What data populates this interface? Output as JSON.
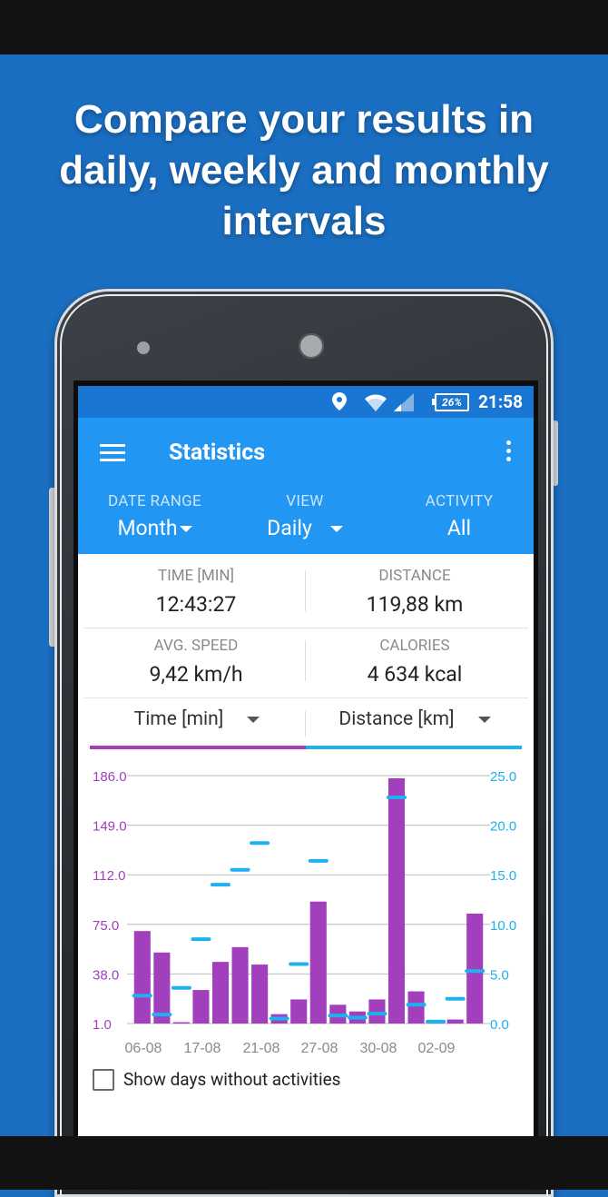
{
  "headline": {
    "line1": "Compare your results in",
    "line2": "daily, weekly and monthly",
    "line3": "intervals"
  },
  "status_bar": {
    "battery": "26%",
    "time": "21:58",
    "icons": [
      "location-icon",
      "wifi-icon",
      "signal-icon",
      "battery-icon"
    ]
  },
  "app_bar": {
    "title": "Statistics",
    "filters": [
      {
        "label": "DATE RANGE",
        "value": "Month"
      },
      {
        "label": "VIEW",
        "value": "Daily"
      },
      {
        "label": "ACTIVITY",
        "value": "All"
      }
    ]
  },
  "stats": {
    "time_label": "TIME [MIN]",
    "time_value": "12:43:27",
    "distance_label": "DISTANCE",
    "distance_value": "119,88 km",
    "speed_label": "AVG. SPEED",
    "speed_value": "9,42 km/h",
    "calories_label": "CALORIES",
    "calories_value": "4 634 kcal"
  },
  "selectors": {
    "left": "Time [min]",
    "right": "Distance [km]"
  },
  "colors": {
    "bar": "#a23fbd",
    "line": "#1fb0ee",
    "app_bar": "#2196f3",
    "status_bar": "#1976d2",
    "background": "#1b6fc2"
  },
  "chart_data": {
    "type": "bar",
    "y_left": {
      "ticks": [
        "186.0",
        "149.0",
        "112.0",
        "75.0",
        "38.0",
        "1.0"
      ],
      "range": [
        1,
        186
      ]
    },
    "y_right": {
      "ticks": [
        "25.0",
        "20.0",
        "15.0",
        "10.0",
        "5.0",
        "0.0"
      ],
      "range": [
        0,
        25
      ]
    },
    "x_ticks": [
      "06-08",
      "17-08",
      "21-08",
      "27-08",
      "30-08",
      "02-09"
    ],
    "series": [
      {
        "name": "Time [min]",
        "kind": "bar",
        "values": [
          70,
          54,
          2,
          26,
          47,
          58,
          45,
          8,
          19,
          92,
          15,
          10,
          19,
          184,
          25,
          2,
          4,
          83
        ]
      },
      {
        "name": "Distance [km]",
        "kind": "marker",
        "values": [
          2.8,
          0.9,
          3.6,
          8.5,
          14.0,
          15.5,
          18.2,
          0.5,
          6.0,
          16.4,
          0.8,
          0.6,
          1.0,
          22.8,
          1.9,
          0.2,
          2.5,
          5.3
        ]
      }
    ]
  },
  "footer": {
    "checkbox_label": "Show days without activities"
  }
}
